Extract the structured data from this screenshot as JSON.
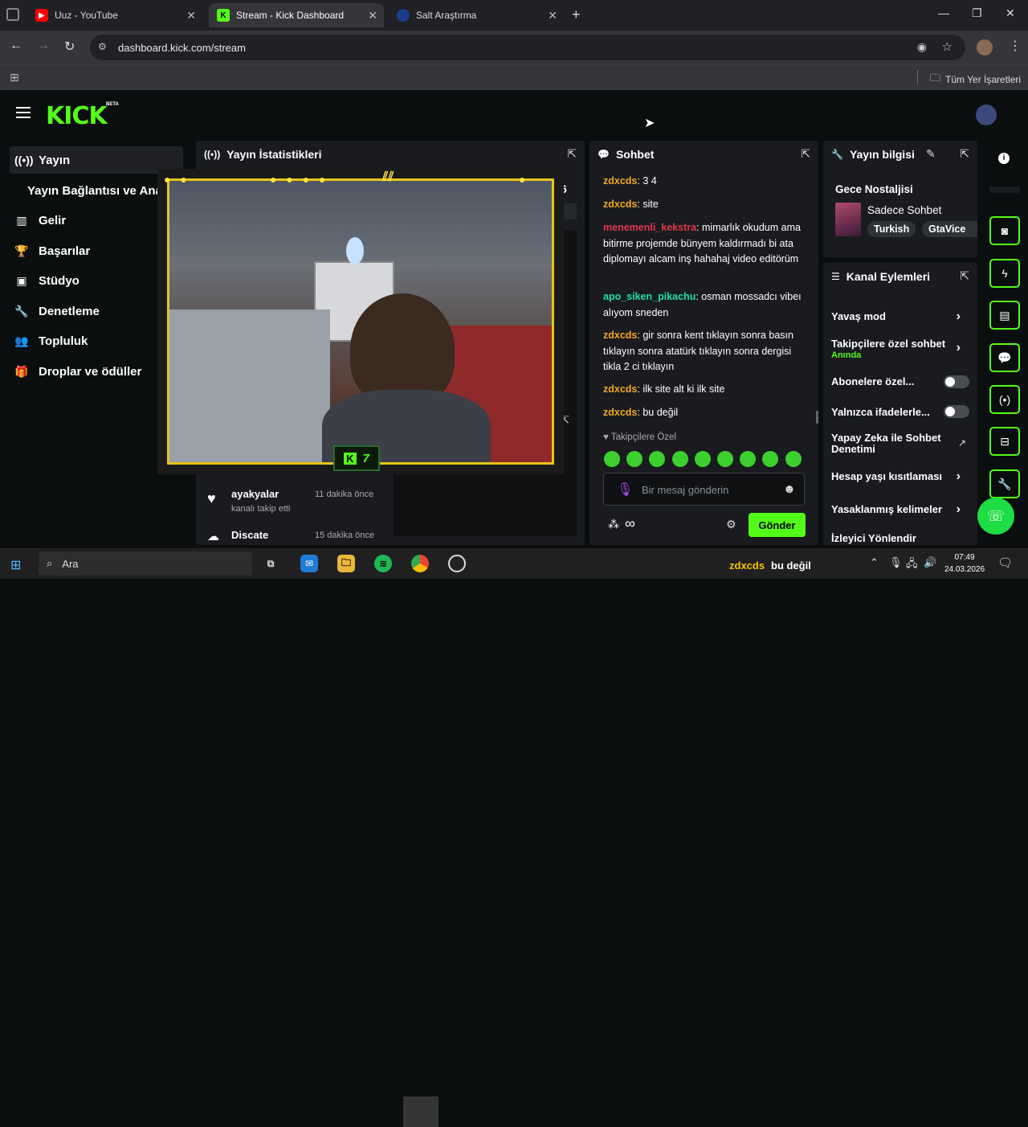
{
  "browser": {
    "tabs": [
      {
        "label": "Uuz - YouTube",
        "icon": "youtube-icon"
      },
      {
        "label": "Stream - Kick Dashboard",
        "icon": "kick-icon"
      },
      {
        "label": "Salt Araştırma",
        "icon": "salt-icon"
      }
    ],
    "url": "dashboard.kick.com/stream",
    "bookmarks_label": "Tüm Yer İşaretleri"
  },
  "kick": {
    "logo": "KICK",
    "beta": "BETA"
  },
  "sidebar": {
    "items": [
      {
        "label": "Yayın",
        "icon": "broadcast-icon"
      },
      {
        "label": "Yayın Bağlantısı ve Ana",
        "icon": ""
      },
      {
        "label": "Gelir",
        "icon": "chart-icon"
      },
      {
        "label": "Başarılar",
        "icon": "trophy-icon"
      },
      {
        "label": "Stüdyo",
        "icon": "studio-icon"
      },
      {
        "label": "Denetleme",
        "icon": "wrench-icon"
      },
      {
        "label": "Topluluk",
        "icon": "community-icon"
      },
      {
        "label": "Droplar ve ödüller",
        "icon": "gift-icon"
      }
    ]
  },
  "stats": {
    "title": "Yayın İstatistikleri",
    "partial_value": "6"
  },
  "activity": [
    {
      "user": "ayakyalar",
      "time": "11 dakika önce",
      "desc": "kanalı takip etti"
    },
    {
      "user": "Discate",
      "time": "15 dakika önce",
      "desc": ""
    }
  ],
  "overlay": {
    "badge": "7"
  },
  "chat": {
    "title": "Sohbet",
    "messages": [
      {
        "user": "zdxcds",
        "text": "3 4",
        "color": "#f5a623"
      },
      {
        "user": "zdxcds",
        "text": "site",
        "color": "#f5a623"
      },
      {
        "user": "menemenli_kekstra",
        "text": "mimarlık okudum ama bitirme projemde bünyem kaldırmadı bi ata diplomayı alcam inş hahahaj video editörüm",
        "color": "#e0364a"
      },
      {
        "user": "apo_siken_pikachu",
        "text": "osman mossadcı vibeı alıyom sneden",
        "color": "#1ee0a6"
      },
      {
        "user": "zdxcds",
        "text": "gir sonra kent tıklayın sonra basın tıklayın sonra atatürk tıklayın sonra dergisi tikla 2 ci tıklayın",
        "color": "#f5a623"
      },
      {
        "user": "zdxcds",
        "text": "ilk site alt ki ilk site",
        "color": "#f5a623"
      },
      {
        "user": "zdxcds",
        "text": "bu değil",
        "color": "#f5a623"
      }
    ],
    "followers_only": "Takipçilere Özel",
    "placeholder": "Bir mesaj gönderin",
    "send": "Gönder",
    "infinity": "∞"
  },
  "stream_info": {
    "title": "Yayın bilgisi",
    "stream_title": "Gece Nostaljisi",
    "category": "Sadece Sohbet",
    "tags": [
      "Turkish",
      "GtaVice"
    ]
  },
  "channel_actions": {
    "title": "Kanal Eylemleri",
    "items": [
      {
        "label": "Yavaş mod",
        "sub": ""
      },
      {
        "label": "Takipçilere özel sohbet",
        "sub": "Anında"
      },
      {
        "label": "Abonelere özel...",
        "sub": ""
      },
      {
        "label": "Yalnızca ifadelerle...",
        "sub": ""
      },
      {
        "label": "Yapay Zeka ile Sohbet Denetimi",
        "sub": ""
      },
      {
        "label": "Hesap yaşı kısıtlaması",
        "sub": ""
      },
      {
        "label": "Yasaklanmış kelimeler",
        "sub": ""
      },
      {
        "label": "İzleyici Yönlendir",
        "sub": ""
      }
    ]
  },
  "taskbar": {
    "search": "Ara",
    "now_playing_user": "zdxcds",
    "now_playing_text": "bu değil",
    "time": "07:49",
    "date": "24.03.2026"
  },
  "colors": {
    "accent": "#53fc18",
    "panel": "#191b1f",
    "background": "#0b0e0f"
  }
}
